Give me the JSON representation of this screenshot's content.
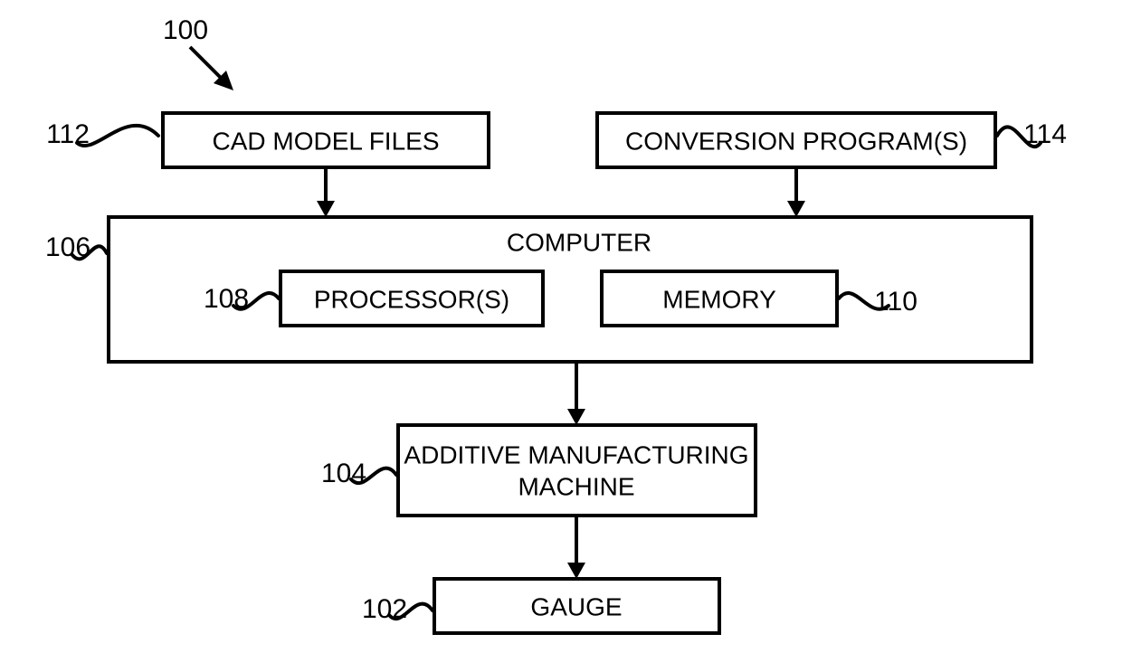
{
  "diagram": {
    "title_ref": "100",
    "blocks": {
      "cad": {
        "label": "CAD MODEL FILES",
        "ref": "112"
      },
      "conv": {
        "label": "CONVERSION PROGRAM(S)",
        "ref": "114"
      },
      "computer": {
        "label": "COMPUTER",
        "ref": "106"
      },
      "processor": {
        "label": "PROCESSOR(S)",
        "ref": "108"
      },
      "memory": {
        "label": "MEMORY",
        "ref": "110"
      },
      "am": {
        "label_line1": "ADDITIVE MANUFACTURING",
        "label_line2": "MACHINE",
        "ref": "104"
      },
      "gauge": {
        "label": "GAUGE",
        "ref": "102"
      }
    }
  }
}
